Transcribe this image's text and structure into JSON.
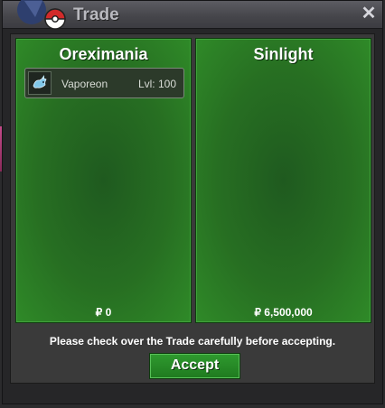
{
  "window": {
    "title": "Trade",
    "close_icon": "close-icon",
    "logo_icon": "pokeball-logo-icon"
  },
  "left_panel": {
    "player_name": "Oreximania",
    "pokemon": [
      {
        "name": "Vaporeon",
        "level": "Lvl: 100",
        "icon": "vaporeon-sprite-icon"
      }
    ],
    "money": "₽ 0"
  },
  "right_panel": {
    "player_name": "Sinlight",
    "pokemon": [],
    "money": "₽ 6,500,000"
  },
  "message": "Please check over the Trade carefully before accepting.",
  "accept_label": "Accept",
  "colors": {
    "panel_green": "#276f22",
    "accept_green": "#2f9a2f",
    "titlebar_grey": "#45454a"
  }
}
